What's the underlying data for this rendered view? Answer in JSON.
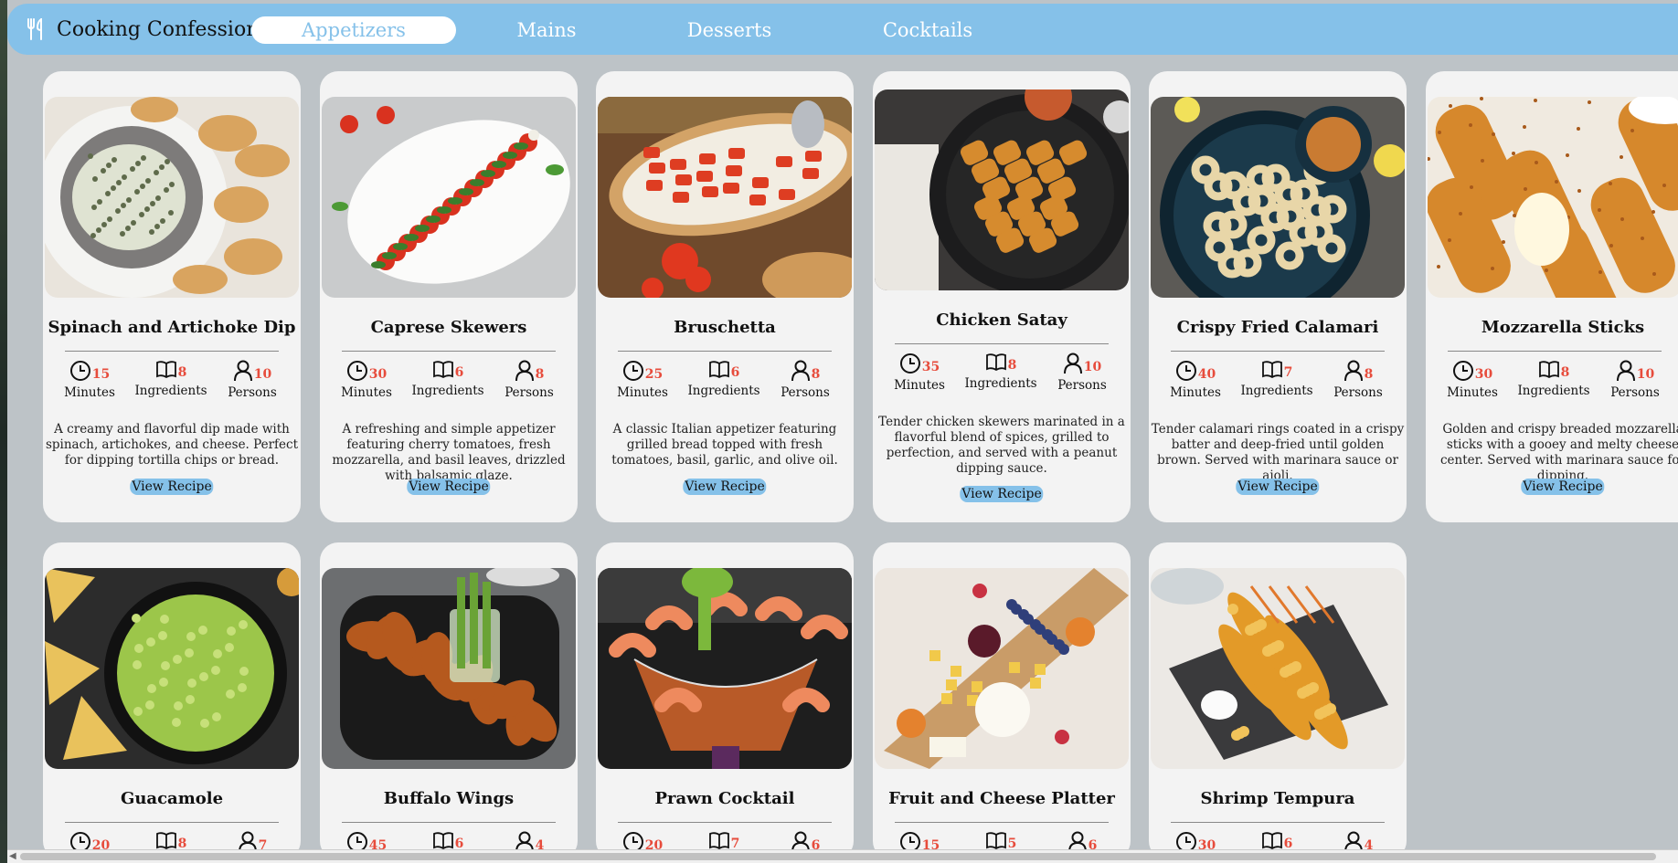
{
  "app": {
    "brand_name": "Cooking Confessions"
  },
  "nav": {
    "tabs": [
      {
        "label": "Appetizers",
        "active": true
      },
      {
        "label": "Mains"
      },
      {
        "label": "Desserts"
      },
      {
        "label": "Cocktails"
      }
    ]
  },
  "colors": {
    "accent": "#85c1e9",
    "stat_value": "#e74c3c",
    "page_bg": "#bdc3c7",
    "card_bg": "#f3f3f3"
  },
  "labels": {
    "minutes": "Minutes",
    "ingredients": "Ingredients",
    "persons": "Persons",
    "view_recipe": "View Recipe"
  },
  "cards": [
    {
      "title": "Spinach and Artichoke Dip",
      "minutes": "15",
      "ingredients": "8",
      "persons": "10",
      "description": "A creamy and flavorful dip made with spinach, artichokes, and cheese. Perfect for dipping tortilla chips or bread."
    },
    {
      "title": "Caprese Skewers",
      "minutes": "30",
      "ingredients": "6",
      "persons": "8",
      "description": "A refreshing and simple appetizer featuring cherry tomatoes, fresh mozzarella, and basil leaves, drizzled with balsamic glaze."
    },
    {
      "title": "Bruschetta",
      "minutes": "25",
      "ingredients": "6",
      "persons": "8",
      "description": "A classic Italian appetizer featuring grilled bread topped with fresh tomatoes, basil, garlic, and olive oil."
    },
    {
      "title": "Chicken Satay",
      "minutes": "35",
      "ingredients": "8",
      "persons": "10",
      "description": "Tender chicken skewers marinated in a flavorful blend of spices, grilled to perfection, and served with a peanut dipping sauce."
    },
    {
      "title": "Crispy Fried Calamari",
      "minutes": "40",
      "ingredients": "7",
      "persons": "8",
      "description": "Tender calamari rings coated in a crispy batter and deep-fried until golden brown. Served with marinara sauce or aioli."
    },
    {
      "title": "Mozzarella Sticks",
      "minutes": "30",
      "ingredients": "8",
      "persons": "10",
      "description": "Golden and crispy breaded mozzarella sticks with a gooey and melty cheese center. Served with marinara sauce for dipping."
    },
    {
      "title": "Guacamole",
      "minutes": "20",
      "ingredients": "8",
      "persons": "7",
      "description": ""
    },
    {
      "title": "Buffalo Wings",
      "minutes": "45",
      "ingredients": "6",
      "persons": "4",
      "description": ""
    },
    {
      "title": "Prawn Cocktail",
      "minutes": "20",
      "ingredients": "7",
      "persons": "6",
      "description": ""
    },
    {
      "title": "Fruit and Cheese Platter",
      "minutes": "15",
      "ingredients": "5",
      "persons": "6",
      "description": ""
    },
    {
      "title": "Shrimp Tempura",
      "minutes": "30",
      "ingredients": "6",
      "persons": "4",
      "description": ""
    }
  ]
}
